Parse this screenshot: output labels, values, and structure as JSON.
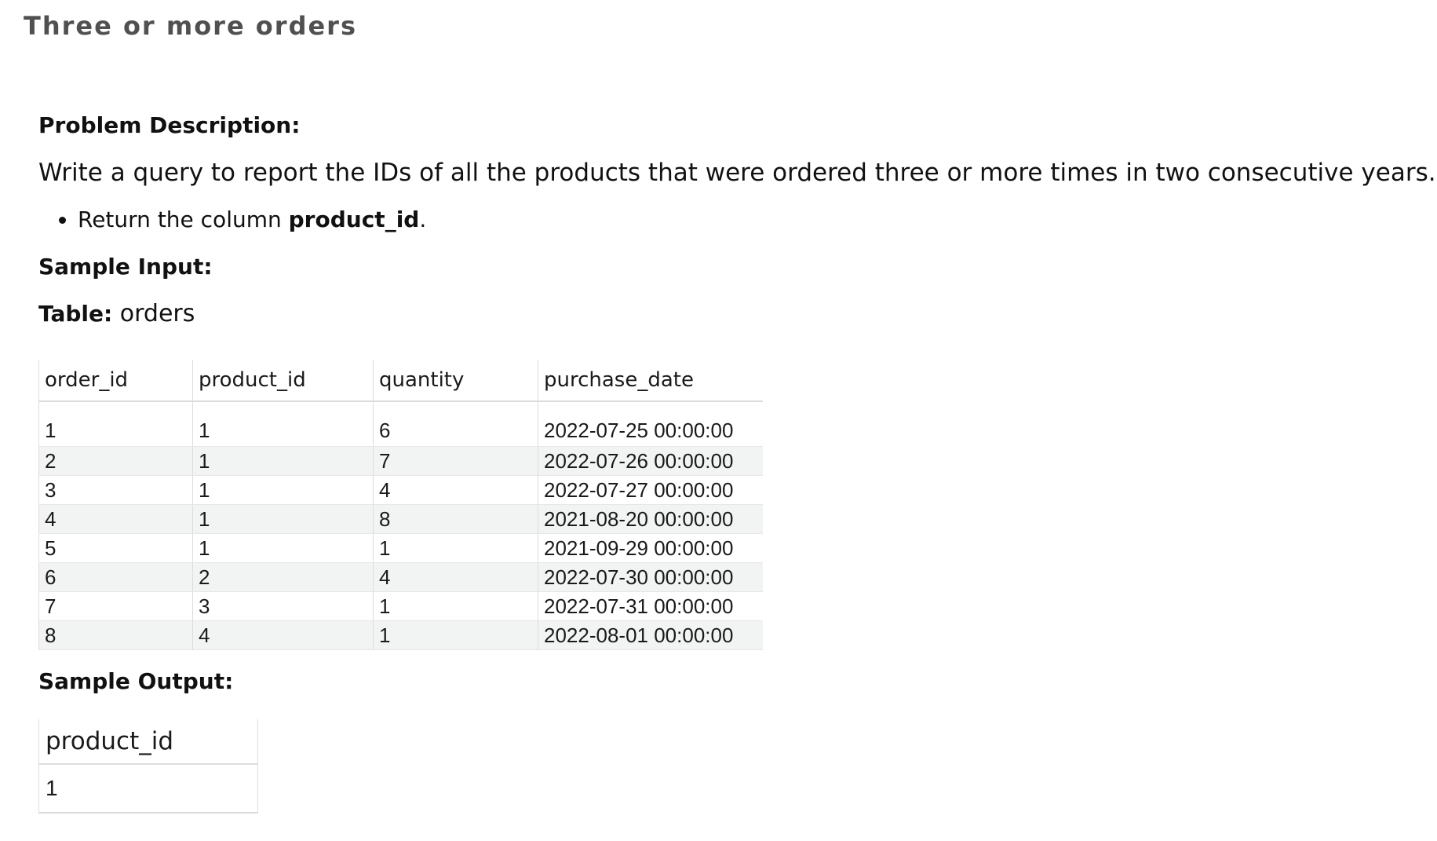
{
  "page": {
    "title": "Three or more orders"
  },
  "problem": {
    "heading": "Problem Description:",
    "description": "Write a query to report the IDs of all the products that were ordered three or more times in two consecutive years.",
    "bullet_prefix": "Return the column ",
    "bullet_bold": "product_id",
    "bullet_suffix": "."
  },
  "sample_input": {
    "heading": "Sample Input:",
    "table_label": "Table:",
    "table_name": "orders",
    "columns": [
      "order_id",
      "product_id",
      "quantity",
      "purchase_date"
    ],
    "rows": [
      [
        "1",
        "1",
        "6",
        "2022-07-25 00:00:00"
      ],
      [
        "2",
        "1",
        "7",
        "2022-07-26 00:00:00"
      ],
      [
        "3",
        "1",
        "4",
        "2022-07-27 00:00:00"
      ],
      [
        "4",
        "1",
        "8",
        "2021-08-20 00:00:00"
      ],
      [
        "5",
        "1",
        "1",
        "2021-09-29 00:00:00"
      ],
      [
        "6",
        "2",
        "4",
        "2022-07-30 00:00:00"
      ],
      [
        "7",
        "3",
        "1",
        "2022-07-31 00:00:00"
      ],
      [
        "8",
        "4",
        "1",
        "2022-08-01 00:00:00"
      ]
    ]
  },
  "sample_output": {
    "heading": "Sample Output:",
    "columns": [
      "product_id"
    ],
    "rows": [
      [
        "1"
      ]
    ]
  }
}
